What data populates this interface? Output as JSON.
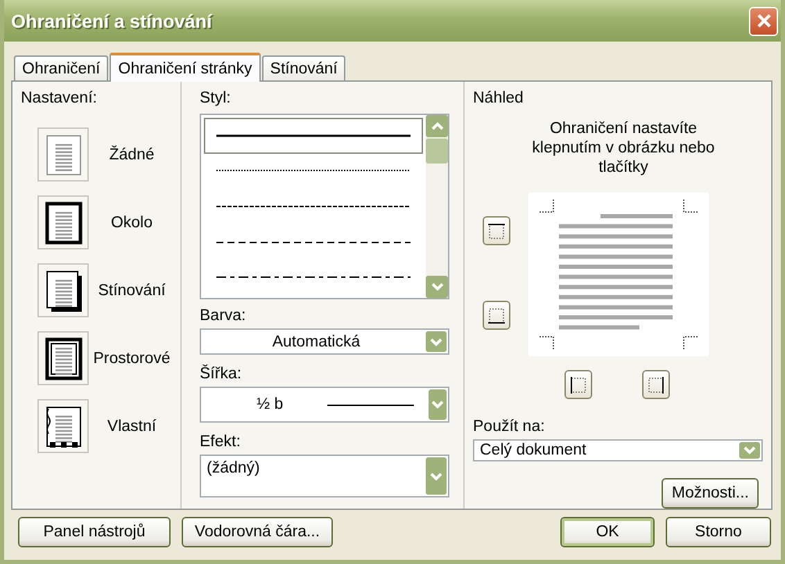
{
  "window": {
    "title": "Ohraničení a stínování"
  },
  "tabs": [
    {
      "label": "Ohraničení",
      "selected": false
    },
    {
      "label": "Ohraničení stránky",
      "selected": true
    },
    {
      "label": "Stínování",
      "selected": false
    }
  ],
  "settings": {
    "label": "Nastavení:",
    "items": [
      {
        "label": "Žádné",
        "kind": "none"
      },
      {
        "label": "Okolo",
        "kind": "box"
      },
      {
        "label": "Stínování",
        "kind": "shadow"
      },
      {
        "label": "Prostorové",
        "kind": "raised"
      },
      {
        "label": "Vlastní",
        "kind": "custom"
      }
    ]
  },
  "style": {
    "label": "Styl:",
    "lines": [
      {
        "kind": "solid",
        "selected": true
      },
      {
        "kind": "dotted",
        "selected": false
      },
      {
        "kind": "dashed-fine",
        "selected": false
      },
      {
        "kind": "dashed",
        "selected": false
      },
      {
        "kind": "dash-dot",
        "selected": false
      }
    ]
  },
  "color": {
    "label": "Barva:",
    "value": "Automatická"
  },
  "width": {
    "label": "Šířka:",
    "value": "½ b"
  },
  "effect": {
    "label": "Efekt:",
    "value": "(žádný)"
  },
  "preview": {
    "label": "Náhled",
    "hint": "Ohraničení nastavíte klepnutím v obrázku nebo tlačítky"
  },
  "apply_to": {
    "label": "Použít na:",
    "value": "Celý dokument"
  },
  "options_button": "Možnosti...",
  "buttons": [
    {
      "label": "Panel nástrojů",
      "default": false
    },
    {
      "label": "Vodorovná čára...",
      "default": false
    },
    {
      "label": "OK",
      "default": true
    },
    {
      "label": "Storno",
      "default": false
    }
  ]
}
